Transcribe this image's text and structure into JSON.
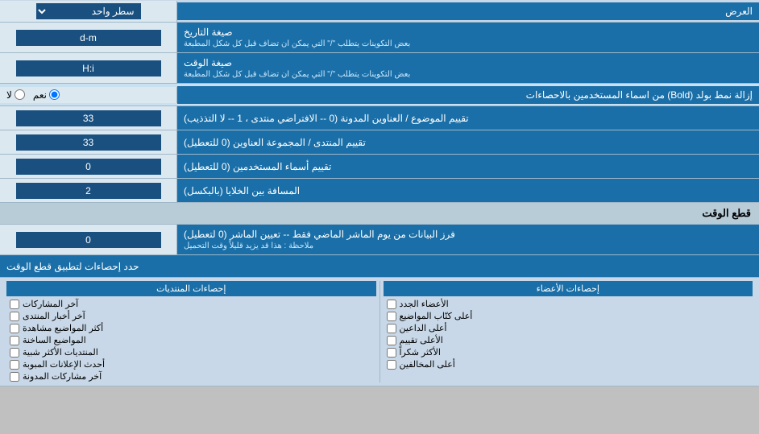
{
  "display": {
    "label": "العرض",
    "options": [
      "سطر واحد"
    ],
    "selected": "سطر واحد"
  },
  "date_format": {
    "label": "صيغة التاريخ",
    "sublabel": "بعض التكوينات يتطلب \"/\" التي يمكن ان تضاف قبل كل شكل المطبعة",
    "value": "d-m"
  },
  "time_format": {
    "label": "صيغة الوقت",
    "sublabel": "بعض التكوينات يتطلب \"/\" التي يمكن ان تضاف قبل كل شكل المطبعة",
    "value": "H:i"
  },
  "bold_remove": {
    "label": "إزالة نمط بولد (Bold) من اسماء المستخدمين بالاحصاءات",
    "options": [
      "نعم",
      "لا"
    ],
    "selected": "نعم"
  },
  "topic_order": {
    "label": "تقييم الموضوع / العناوين المدونة (0 -- الافتراضي منتدى ، 1 -- لا التذذيب)",
    "value": "33"
  },
  "forum_order": {
    "label": "تقييم المنتدى / المجموعة العناوين (0 للتعطيل)",
    "value": "33"
  },
  "user_order": {
    "label": "تقييم أسماء المستخدمين (0 للتعطيل)",
    "value": "0"
  },
  "cell_spacing": {
    "label": "المسافة بين الخلايا (بالبكسل)",
    "value": "2"
  },
  "cut_time": {
    "section_label": "قطع الوقت",
    "filter_label": "فرز البيانات من يوم الماشر الماضي فقط -- تعيين الماشر (0 لتعطيل)",
    "filter_note": "ملاحظة : هذا قد يزيد قليلاً وقت التحميل",
    "filter_value": "0",
    "limit_label": "حدد إحصاءات لتطبيق قطع الوقت"
  },
  "stats_cols": {
    "col1_header": "إحصاءات المنتديات",
    "col2_header": "إحصاءات الأعضاء",
    "col1_items": [
      {
        "label": "آخر المشاركات",
        "checked": false
      },
      {
        "label": "آخر أخبار المنتدى",
        "checked": false
      },
      {
        "label": "أكثر المواضيع مشاهدة",
        "checked": false
      },
      {
        "label": "المواضيع الساخنة",
        "checked": false
      },
      {
        "label": "المنتديات الأكثر شبية",
        "checked": false
      },
      {
        "label": "أحدث الإعلانات المبوبة",
        "checked": false
      },
      {
        "label": "آخر مشاركات المدونة",
        "checked": false
      }
    ],
    "col2_items": [
      {
        "label": "الأعضاء الجدد",
        "checked": false
      },
      {
        "label": "أعلى كتّاب المواضيع",
        "checked": false
      },
      {
        "label": "أعلى الداعين",
        "checked": false
      },
      {
        "label": "الأعلى تقييم",
        "checked": false
      },
      {
        "label": "الأكثر شكراً",
        "checked": false
      },
      {
        "label": "أعلى المخالفين",
        "checked": false
      }
    ]
  }
}
